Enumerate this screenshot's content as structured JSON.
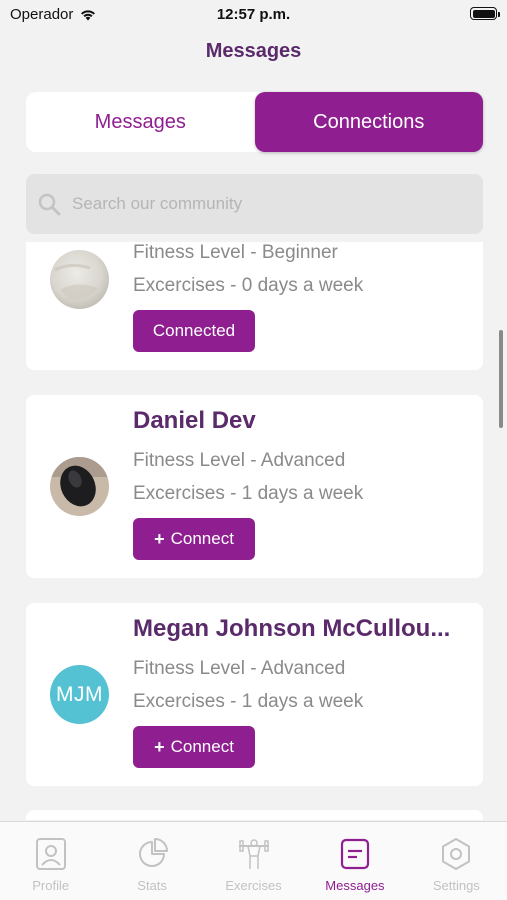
{
  "status_bar": {
    "carrier": "Operador",
    "time": "12:57 p.m."
  },
  "page": {
    "title": "Messages"
  },
  "tabs": [
    {
      "label": "Messages",
      "active": false
    },
    {
      "label": "Connections",
      "active": true
    }
  ],
  "search": {
    "placeholder": "Search our community"
  },
  "users": [
    {
      "name": "",
      "fitness_level": "Fitness Level - Beginner",
      "exercises": "Excercises - 0 days a week",
      "button_label": "Connected",
      "avatar_type": "photo-light"
    },
    {
      "name": "Daniel Dev",
      "fitness_level": "Fitness Level - Advanced",
      "exercises": "Excercises - 1 days a week",
      "button_label": "Connect",
      "avatar_type": "photo-mouse"
    },
    {
      "name": "Megan Johnson McCullou...",
      "fitness_level": "Fitness Level - Advanced",
      "exercises": "Excercises - 1 days a week",
      "button_label": "Connect",
      "avatar_initials": "MJM"
    }
  ],
  "tabbar": [
    {
      "label": "Profile",
      "icon": "profile-icon",
      "active": false
    },
    {
      "label": "Stats",
      "icon": "stats-icon",
      "active": false
    },
    {
      "label": "Exercises",
      "icon": "exercises-icon",
      "active": false
    },
    {
      "label": "Messages",
      "icon": "messages-icon",
      "active": true
    },
    {
      "label": "Settings",
      "icon": "settings-icon",
      "active": false
    }
  ],
  "colors": {
    "accent": "#8f1f91",
    "title": "#5a2a6b",
    "initials_avatar": "#55c2d4"
  }
}
